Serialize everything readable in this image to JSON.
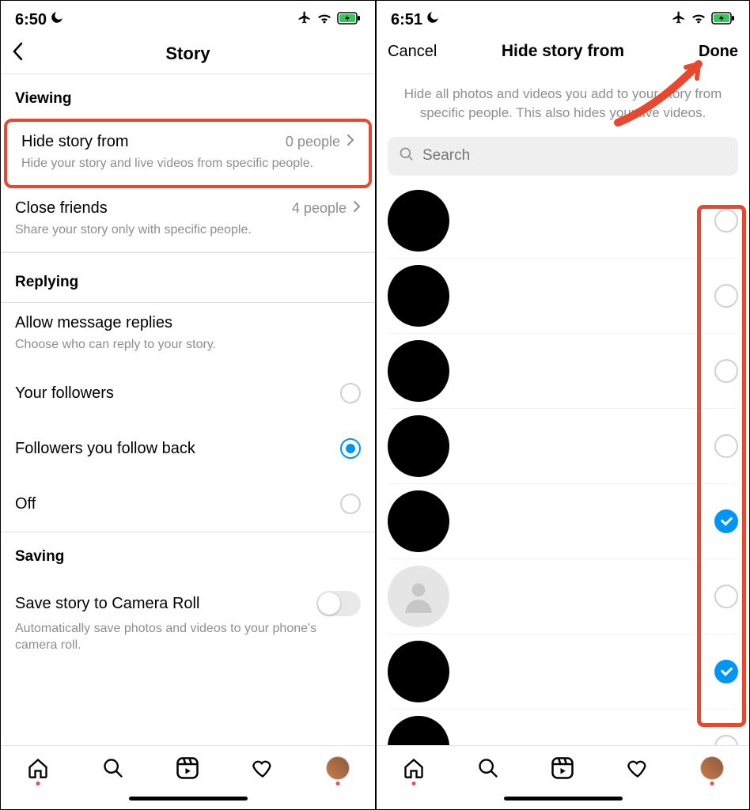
{
  "left": {
    "status_time": "6:50",
    "nav_title": "Story",
    "sections": {
      "viewing": "Viewing",
      "replying": "Replying",
      "saving": "Saving"
    },
    "hide_story": {
      "title": "Hide story from",
      "value": "0 people",
      "sub": "Hide your story and live videos from specific people."
    },
    "close_friends": {
      "title": "Close friends",
      "value": "4 people",
      "sub": "Share your story only with specific people."
    },
    "allow_replies": {
      "title": "Allow message replies",
      "sub": "Choose who can reply to your story."
    },
    "reply_options": {
      "followers": "Your followers",
      "follow_back": "Followers you follow back",
      "off": "Off"
    },
    "save_camera": {
      "title": "Save story to Camera Roll",
      "sub": "Automatically save photos and videos to your phone's camera roll."
    }
  },
  "right": {
    "status_time": "6:51",
    "nav_cancel": "Cancel",
    "nav_title": "Hide story from",
    "nav_done": "Done",
    "description": "Hide all photos and videos you add to your story from specific people. This also hides your live videos.",
    "search_placeholder": "Search",
    "people": [
      {
        "type": "black",
        "checked": false
      },
      {
        "type": "black",
        "checked": false
      },
      {
        "type": "black",
        "checked": false
      },
      {
        "type": "black",
        "checked": false
      },
      {
        "type": "black",
        "checked": true
      },
      {
        "type": "placeholder",
        "checked": false
      },
      {
        "type": "black",
        "checked": true
      },
      {
        "type": "black",
        "checked": false
      }
    ]
  }
}
